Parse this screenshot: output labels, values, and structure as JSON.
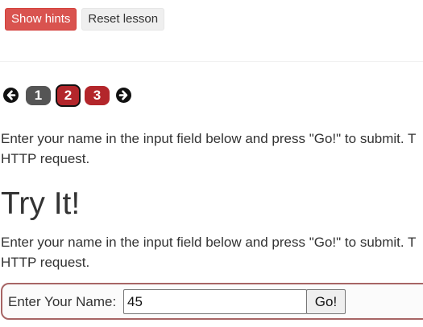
{
  "toolbar": {
    "hints_label": "Show hints",
    "reset_label": "Reset lesson"
  },
  "pagination": {
    "prev_icon": "circle-arrow-left",
    "next_icon": "circle-arrow-right",
    "pages": [
      "1",
      "2",
      "3"
    ],
    "current_page": "2"
  },
  "content": {
    "intro_line1": "Enter your name in the input field below and press \"Go!\" to submit. T",
    "intro_line2": "HTTP request.",
    "heading": "Try It!",
    "body_line1": "Enter your name in the input field below and press \"Go!\" to submit. T",
    "body_line2": "HTTP request."
  },
  "form": {
    "label": "Enter Your Name:",
    "name_value": "45",
    "submit_label": "Go!"
  },
  "colors": {
    "danger": "#d9534f",
    "page_active": "#b3262b",
    "page_inactive": "#555555",
    "form_border": "#a76565"
  }
}
